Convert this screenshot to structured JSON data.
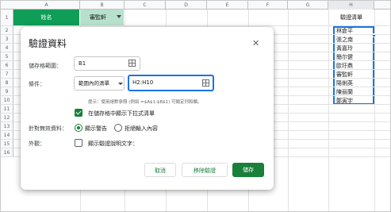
{
  "sheet": {
    "columns": [
      "A",
      "B",
      "C",
      "D",
      "E",
      "F",
      "G",
      "H"
    ],
    "rows": [
      "1",
      "2",
      "3",
      "4",
      "5",
      "6",
      "7",
      "8",
      "9",
      "10",
      "11",
      "12",
      "13",
      "14",
      "15",
      "16"
    ],
    "a1_value": "姓名",
    "b1_value": "審監軒",
    "h1_value": "驗證清單",
    "h_values": [
      "林倉平",
      "張之南",
      "黃嘉玲",
      "簡尔健",
      "歐玗鼎",
      "審監軒",
      "陽俐英",
      "陳丽蘭",
      "鄭寅宇"
    ],
    "header_green": "#0f9d58",
    "selected_green": "#b7e1cd"
  },
  "dialog": {
    "title": "驗證資料",
    "range_label": "儲存格範圍：",
    "range_value": "B1",
    "criteria_label": "條件：",
    "criteria_type": "範圍內的清單",
    "criteria_range": "H2:H10",
    "hint": "提示：使用絕對參照 (例如 =$A$1:$B$1) 可鎖定列和欄。",
    "dropdown_checkbox_label": "在儲存格中顯示下拉式清單",
    "invalid_label": "針對無效資料：",
    "invalid_opt_warning": "顯示警告",
    "invalid_opt_reject": "拒絕輸入內容",
    "appearance_label": "外觀：",
    "help_text_label": "顯示驗證說明文字：",
    "cancel": "取消",
    "remove": "移除驗證",
    "save": "儲存",
    "accent": "#188038"
  }
}
